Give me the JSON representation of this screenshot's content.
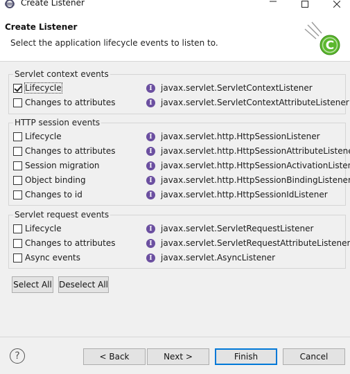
{
  "window": {
    "title": "Create Listener",
    "minimize_icon": "minimize-icon",
    "maximize_icon": "maximize-icon",
    "close_icon": "close-icon"
  },
  "header": {
    "title": "Create Listener",
    "description": "Select the application lifecycle events to listen to.",
    "banner_icon": "wizard-banner-icon",
    "banner_letter": "C"
  },
  "groups": [
    {
      "label": "Servlet context events",
      "items": [
        {
          "label": "Lifecycle",
          "checked": true,
          "interface": "javax.servlet.ServletContextListener"
        },
        {
          "label": "Changes to attributes",
          "checked": false,
          "interface": "javax.servlet.ServletContextAttributeListener"
        }
      ]
    },
    {
      "label": "HTTP session events",
      "items": [
        {
          "label": "Lifecycle",
          "checked": false,
          "interface": "javax.servlet.http.HttpSessionListener"
        },
        {
          "label": "Changes to attributes",
          "checked": false,
          "interface": "javax.servlet.http.HttpSessionAttributeListener"
        },
        {
          "label": "Session migration",
          "checked": false,
          "interface": "javax.servlet.http.HttpSessionActivationListener"
        },
        {
          "label": "Object binding",
          "checked": false,
          "interface": "javax.servlet.http.HttpSessionBindingListener"
        },
        {
          "label": "Changes to id",
          "checked": false,
          "interface": "javax.servlet.http.HttpSessionIdListener"
        }
      ]
    },
    {
      "label": "Servlet request events",
      "items": [
        {
          "label": "Lifecycle",
          "checked": false,
          "interface": "javax.servlet.ServletRequestListener"
        },
        {
          "label": "Changes to attributes",
          "checked": false,
          "interface": "javax.servlet.ServletRequestAttributeListener"
        },
        {
          "label": "Async events",
          "checked": false,
          "interface": "javax.servlet.AsyncListener"
        }
      ]
    }
  ],
  "interface_icon": {
    "name": "interface-icon",
    "glyph": "I",
    "color": "#6b4fa0"
  },
  "selection_buttons": {
    "select_all": "Select All",
    "deselect_all": "Deselect All"
  },
  "footer": {
    "help_icon": "help-icon",
    "help_glyph": "?",
    "back": "< Back",
    "next": "Next >",
    "finish": "Finish",
    "cancel": "Cancel"
  },
  "colors": {
    "accent": "#0078d7",
    "banner_green": "#5cb82e",
    "interface_purple": "#6b4fa0"
  }
}
